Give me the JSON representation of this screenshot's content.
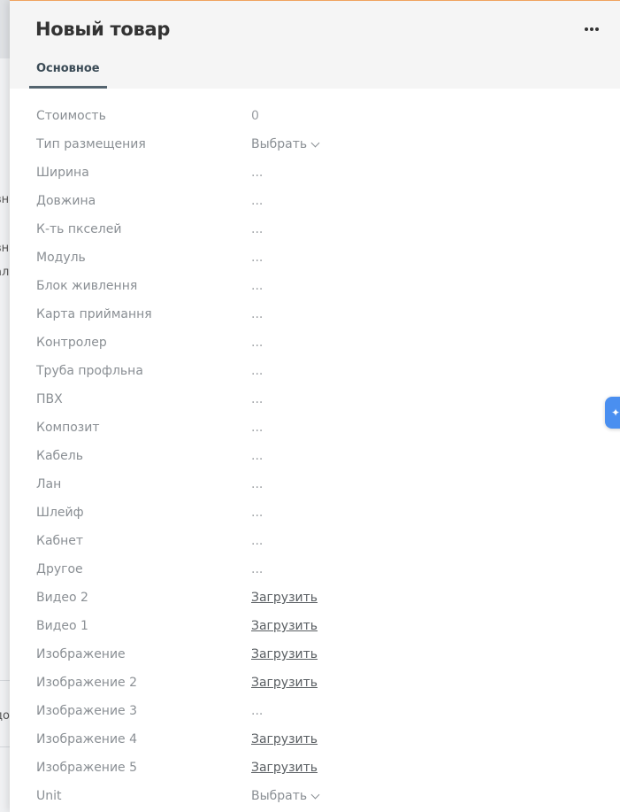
{
  "background": {
    "fragments": [
      "вна",
      "вна",
      "али",
      "до"
    ]
  },
  "header": {
    "title": "Новый товар",
    "more_icon": "ellipsis-horizontal-icon"
  },
  "tabs": [
    {
      "label": "Основное",
      "active": true
    }
  ],
  "fields": [
    {
      "label": "Стоимость",
      "value": "0",
      "kind": "text"
    },
    {
      "label": "Тип размещения",
      "value": "Выбрать",
      "kind": "select"
    },
    {
      "label": "Ширина",
      "value": "...",
      "kind": "text"
    },
    {
      "label": "Довжина",
      "value": "...",
      "kind": "text"
    },
    {
      "label": "К-ть пкселей",
      "value": "...",
      "kind": "text"
    },
    {
      "label": "Модуль",
      "value": "...",
      "kind": "text"
    },
    {
      "label": "Блок живлення",
      "value": "...",
      "kind": "text"
    },
    {
      "label": "Карта приймання",
      "value": "...",
      "kind": "text"
    },
    {
      "label": "Контролер",
      "value": "...",
      "kind": "text"
    },
    {
      "label": "Труба профльна",
      "value": "...",
      "kind": "text"
    },
    {
      "label": "ПВХ",
      "value": "...",
      "kind": "text"
    },
    {
      "label": "Композит",
      "value": "...",
      "kind": "text"
    },
    {
      "label": "Кабель",
      "value": "...",
      "kind": "text"
    },
    {
      "label": "Лан",
      "value": "...",
      "kind": "text"
    },
    {
      "label": "Шлейф",
      "value": "...",
      "kind": "text"
    },
    {
      "label": "Кабнет",
      "value": "...",
      "kind": "text"
    },
    {
      "label": "Другое",
      "value": "...",
      "kind": "text"
    },
    {
      "label": "Видео 2",
      "value": "Загрузить",
      "kind": "link"
    },
    {
      "label": "Видео 1",
      "value": "Загрузить",
      "kind": "link"
    },
    {
      "label": "Изображение",
      "value": "Загрузить",
      "kind": "link"
    },
    {
      "label": "Изображение 2",
      "value": "Загрузить",
      "kind": "link"
    },
    {
      "label": "Изображение 3",
      "value": "...",
      "kind": "text"
    },
    {
      "label": "Изображение 4",
      "value": "Загрузить",
      "kind": "link"
    },
    {
      "label": "Изображение 5",
      "value": "Загрузить",
      "kind": "link"
    },
    {
      "label": "Unit",
      "value": "Выбрать",
      "kind": "select"
    }
  ],
  "side_button": {
    "icon": "sparkle-icon",
    "color": "#4a8ff0"
  },
  "colors": {
    "accent_top_border": "#f0a35e",
    "tab_underline": "#54646f"
  }
}
